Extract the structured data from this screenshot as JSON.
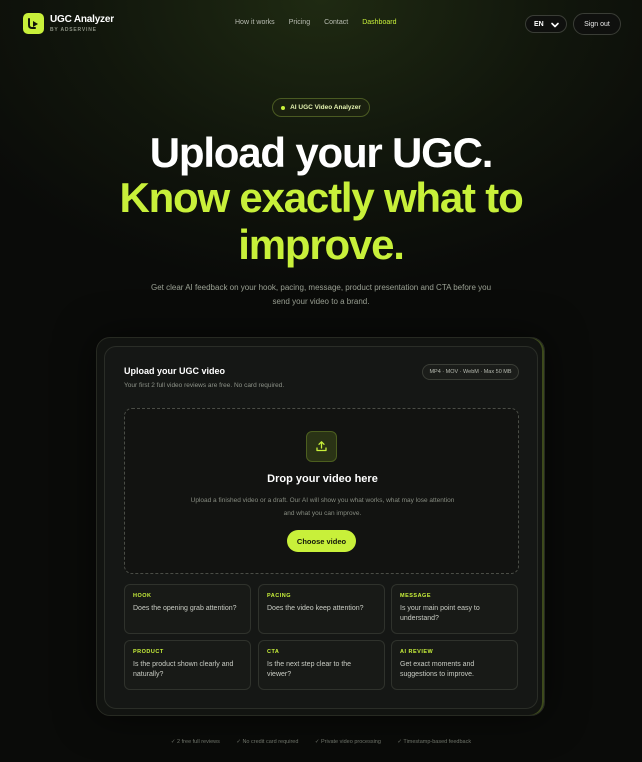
{
  "nav": {
    "logo_title": "UGC Analyzer",
    "logo_sub": "BY ADSERVINE",
    "links": [
      "How it works",
      "Pricing",
      "Contact",
      "Dashboard"
    ],
    "active_link": "Dashboard",
    "lang": "EN",
    "signout": "Sign out"
  },
  "hero": {
    "pill": "AI UGC Video Analyzer",
    "line1": "Upload your UGC.",
    "line2": "Know exactly what to",
    "line3": "improve.",
    "subtitle": "Get clear AI feedback on your hook, pacing, message, product presentation and CTA before you send your video to a brand."
  },
  "upload": {
    "title": "Upload your UGC video",
    "sub": "Your first 2 full video reviews are free. No card required.",
    "formats": "MP4 · MOV · WebM · Max 50 MB",
    "drop_title": "Drop your video here",
    "drop_desc": "Upload a finished video or a draft. Our AI will show you what works, what may lose attention and what you can improve.",
    "choose": "Choose video"
  },
  "tiles": [
    {
      "label": "HOOK",
      "text": "Does the opening grab attention?"
    },
    {
      "label": "PACING",
      "text": "Does the video keep attention?"
    },
    {
      "label": "MESSAGE",
      "text": "Is your main point easy to understand?"
    },
    {
      "label": "PRODUCT",
      "text": "Is the product shown clearly and naturally?"
    },
    {
      "label": "CTA",
      "text": "Is the next step clear to the viewer?"
    },
    {
      "label": "AI REVIEW",
      "text": "Get exact moments and suggestions to improve."
    }
  ],
  "footer": [
    "✓ 2 free full reviews",
    "✓ No credit card required",
    "✓ Private video processing",
    "✓ Timestamp-based feedback"
  ],
  "colors": {
    "accent": "#c8f03a",
    "background": "#0a0b09"
  }
}
